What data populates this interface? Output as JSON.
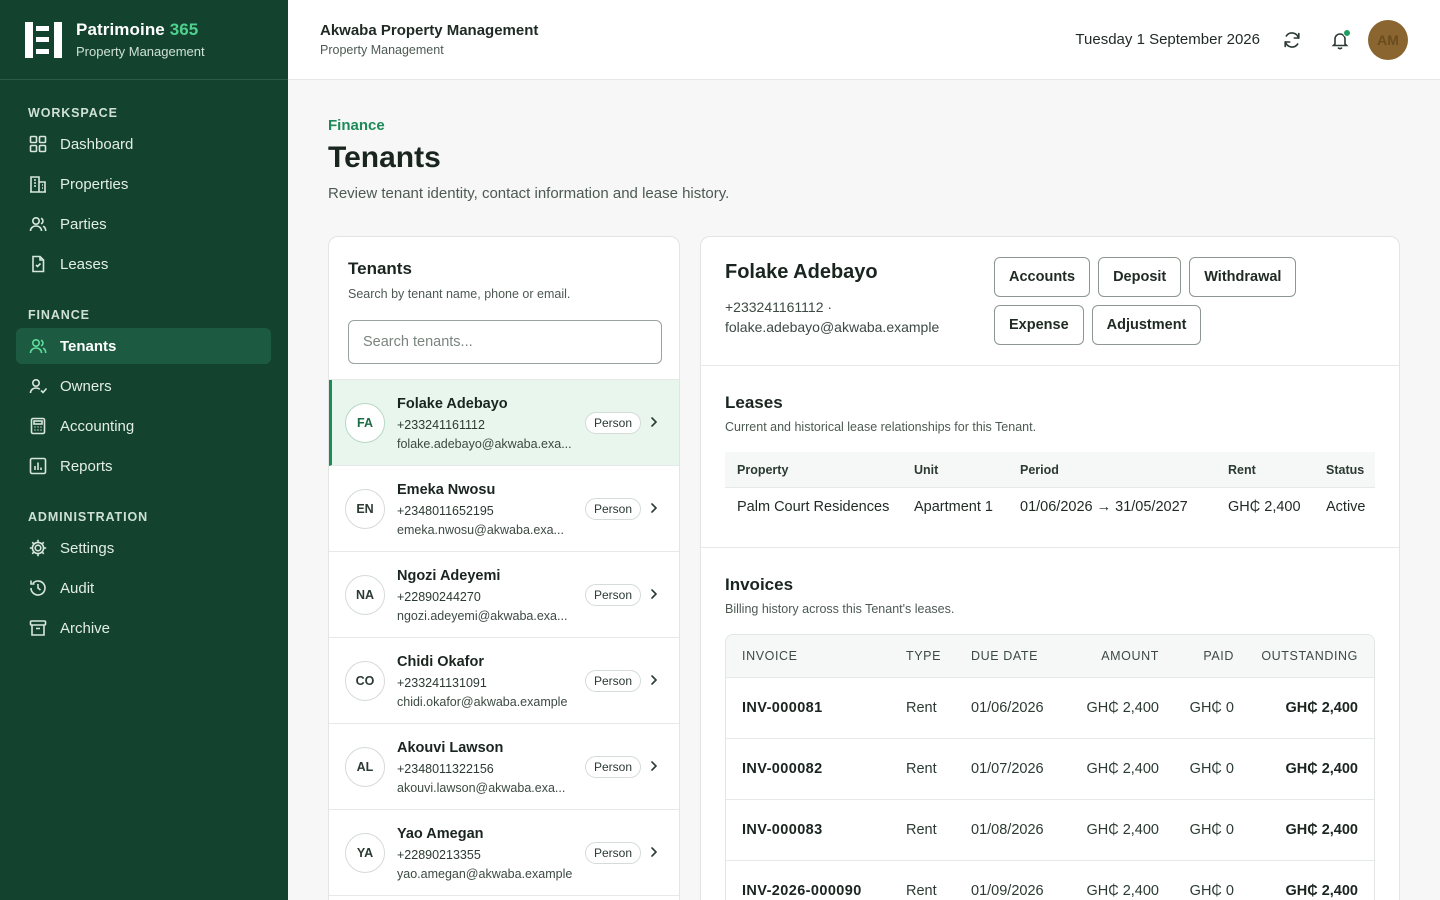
{
  "brand": {
    "name": "Patrimoine",
    "name_accent": "365",
    "subtitle": "Property Management"
  },
  "sidebar": {
    "sections": [
      {
        "title": "WORKSPACE",
        "items": [
          {
            "label": "Dashboard",
            "icon": "grid-icon"
          },
          {
            "label": "Properties",
            "icon": "building-icon"
          },
          {
            "label": "Parties",
            "icon": "users-icon"
          },
          {
            "label": "Leases",
            "icon": "document-icon"
          }
        ]
      },
      {
        "title": "FINANCE",
        "items": [
          {
            "label": "Tenants",
            "icon": "users-icon",
            "active": true
          },
          {
            "label": "Owners",
            "icon": "user-check-icon"
          },
          {
            "label": "Accounting",
            "icon": "calculator-icon"
          },
          {
            "label": "Reports",
            "icon": "bar-chart-icon"
          }
        ]
      },
      {
        "title": "ADMINISTRATION",
        "items": [
          {
            "label": "Settings",
            "icon": "gear-icon"
          },
          {
            "label": "Audit",
            "icon": "history-icon"
          },
          {
            "label": "Archive",
            "icon": "archive-icon"
          }
        ]
      }
    ]
  },
  "topbar": {
    "org_name": "Akwaba Property Management",
    "org_sub": "Property Management",
    "date": "Tuesday 1 September 2026",
    "avatar_initials": "AM"
  },
  "page": {
    "breadcrumb": "Finance",
    "title": "Tenants",
    "description": "Review tenant identity, contact information and lease history."
  },
  "tenant_list": {
    "title": "Tenants",
    "subtitle": "Search by tenant name, phone or email.",
    "search_placeholder": "Search tenants...",
    "items": [
      {
        "initials": "FA",
        "name": "Folake Adebayo",
        "phone": "+233241161112",
        "email": "folake.adebayo@akwaba.exa...",
        "badge": "Person",
        "selected": true
      },
      {
        "initials": "EN",
        "name": "Emeka Nwosu",
        "phone": "+2348011652195",
        "email": "emeka.nwosu@akwaba.exa...",
        "badge": "Person"
      },
      {
        "initials": "NA",
        "name": "Ngozi Adeyemi",
        "phone": "+22890244270",
        "email": "ngozi.adeyemi@akwaba.exa...",
        "badge": "Person"
      },
      {
        "initials": "CO",
        "name": "Chidi Okafor",
        "phone": "+233241131091",
        "email": "chidi.okafor@akwaba.example",
        "badge": "Person"
      },
      {
        "initials": "AL",
        "name": "Akouvi Lawson",
        "phone": "+2348011322156",
        "email": "akouvi.lawson@akwaba.exa...",
        "badge": "Person"
      },
      {
        "initials": "YA",
        "name": "Yao Amegan",
        "phone": "+22890213355",
        "email": "yao.amegan@akwaba.example",
        "badge": "Person"
      }
    ]
  },
  "detail": {
    "name": "Folake Adebayo",
    "phone_line": "+233241161112 ·",
    "email": "folake.adebayo@akwaba.example",
    "actions": [
      "Accounts",
      "Deposit",
      "Withdrawal",
      "Expense",
      "Adjustment"
    ],
    "leases": {
      "title": "Leases",
      "subtitle": "Current and historical lease relationships for this Tenant.",
      "columns": [
        "Property",
        "Unit",
        "Period",
        "Rent",
        "Status"
      ],
      "rows": [
        {
          "property": "Palm Court Residences",
          "unit": "Apartment 1",
          "period": "01/06/2026 → 31/05/2027",
          "rent": "GH₵ 2,400",
          "status": "Active"
        }
      ]
    },
    "invoices": {
      "title": "Invoices",
      "subtitle": "Billing history across this Tenant's leases.",
      "columns": [
        "INVOICE",
        "TYPE",
        "DUE DATE",
        "AMOUNT",
        "PAID",
        "OUTSTANDING"
      ],
      "rows": [
        {
          "invoice": "INV-000081",
          "type": "Rent",
          "due": "01/06/2026",
          "amount": "GH₵ 2,400",
          "paid": "GH₵ 0",
          "outstanding": "GH₵ 2,400"
        },
        {
          "invoice": "INV-000082",
          "type": "Rent",
          "due": "01/07/2026",
          "amount": "GH₵ 2,400",
          "paid": "GH₵ 0",
          "outstanding": "GH₵ 2,400"
        },
        {
          "invoice": "INV-000083",
          "type": "Rent",
          "due": "01/08/2026",
          "amount": "GH₵ 2,400",
          "paid": "GH₵ 0",
          "outstanding": "GH₵ 2,400"
        },
        {
          "invoice": "INV-2026-000090",
          "type": "Rent",
          "due": "01/09/2026",
          "amount": "GH₵ 2,400",
          "paid": "GH₵ 0",
          "outstanding": "GH₵ 2,400"
        }
      ]
    }
  },
  "colors": {
    "sidebar_bg": "#13432f",
    "accent": "#1d8a57",
    "accent_light": "#4fd18e",
    "selected_row_bg": "#e8f6ee"
  }
}
